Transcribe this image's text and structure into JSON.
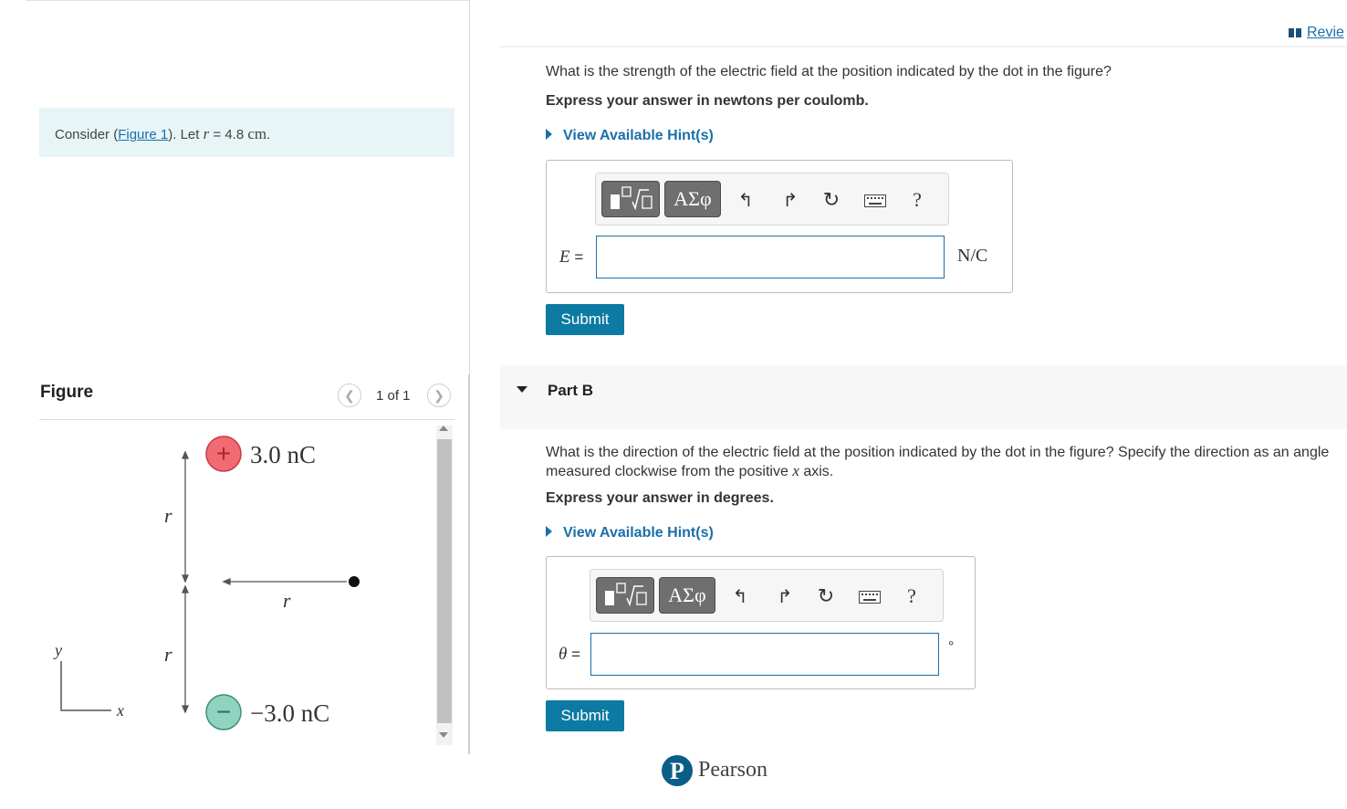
{
  "app": {
    "review_label": "Revie"
  },
  "context": {
    "consider_prefix": "Consider (",
    "figure_link": "Figure 1",
    "consider_mid": "). Let ",
    "var_r": "r",
    "equals_value": " = 4.8 ",
    "unit": "cm",
    "period": "."
  },
  "figure_panel": {
    "title": "Figure",
    "pager_text": "1 of 1",
    "prev_icon": "chevron-left-icon",
    "next_icon": "chevron-right-icon",
    "figure": {
      "charge_top_label": "3.0 nC",
      "charge_bottom_label": "−3.0 nC",
      "charge_top_sign": "+",
      "charge_bottom_sign": "−",
      "dist_top_label": "r",
      "dist_bottom_label": "r",
      "dist_horizontal_label": "r",
      "axis_y_label": "y",
      "axis_x_label": "x",
      "positive_color": "#f06b73",
      "negative_color": "#8fd3c0"
    }
  },
  "part_a": {
    "question": "What is the strength of the electric field at the position indicated by the dot in the figure?",
    "express": "Express your answer in newtons per coulomb.",
    "hint": "View Available Hint(s)",
    "var_label": "E",
    "var_eq": " =",
    "unit": "N/C",
    "input_value": "",
    "submit": "Submit",
    "toolbar": {
      "templates_icon": "math-templates-icon",
      "greek_label": "ΑΣφ",
      "undo_icon": "undo-icon",
      "redo_icon": "redo-icon",
      "reset_icon": "reset-icon",
      "keyboard_icon": "keyboard-icon",
      "help_label": "?"
    }
  },
  "part_b": {
    "title": "Part B",
    "question_line1": "What is the direction of the electric field at the position indicated by the dot in the figure? Specify the direction as an angle",
    "question_line2_prefix": "measured clockwise from the positive ",
    "question_var": "x",
    "question_line2_suffix": " axis.",
    "express": "Express your answer in degrees.",
    "hint": "View Available Hint(s)",
    "var_label": "θ",
    "var_eq": " =",
    "unit": "°",
    "input_value": "",
    "submit": "Submit",
    "toolbar": {
      "greek_label": "ΑΣφ",
      "help_label": "?"
    }
  },
  "footer": {
    "brand": "Pearson",
    "logo_letter": "P"
  }
}
